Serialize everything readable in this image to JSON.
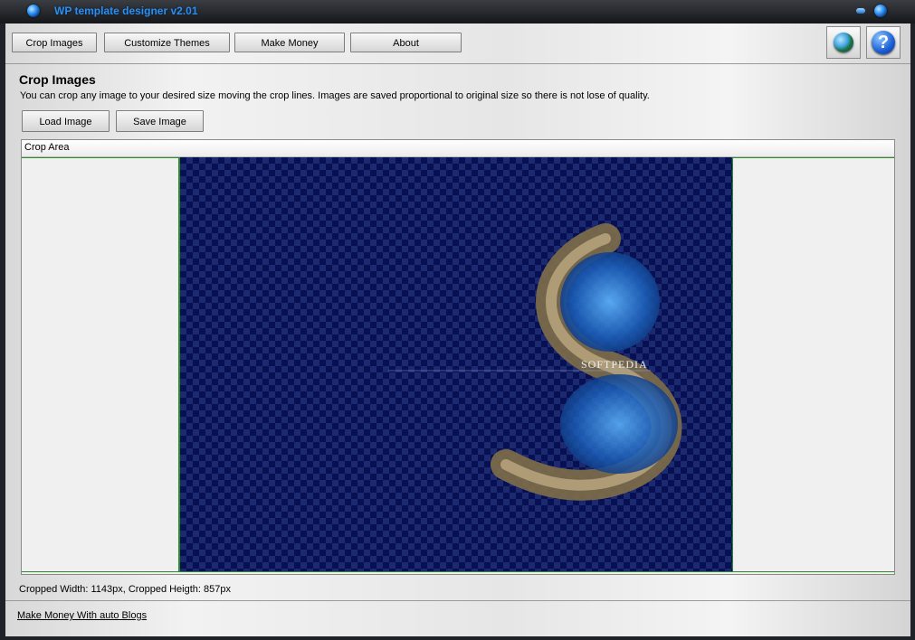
{
  "app": {
    "title": "WP template designer v2.01"
  },
  "toolbar": {
    "tabs": [
      {
        "label": "Crop Images"
      },
      {
        "label": "Customize Themes"
      },
      {
        "label": "Make Money"
      },
      {
        "label": "About"
      }
    ],
    "right_icons": [
      "globe-icon",
      "help-icon"
    ]
  },
  "crop_section": {
    "title": "Crop Images",
    "description": "You can crop any image to your desired size moving the crop lines. Images are saved proportional to original size so there is not lose of quality.",
    "load_label": "Load Image",
    "save_label": "Save Image",
    "crop_area_label": "Crop Area",
    "image_text": "SOFTPEDIA"
  },
  "status": {
    "cropped_text": "Cropped Width: 1143px, Cropped Heigth: 857px"
  },
  "footer": {
    "link_label": "Make Money With auto Blogs"
  },
  "colors": {
    "crop_line": "#2c8a2c",
    "image_bg": "#061052",
    "title_text": "#2f8fe8"
  }
}
